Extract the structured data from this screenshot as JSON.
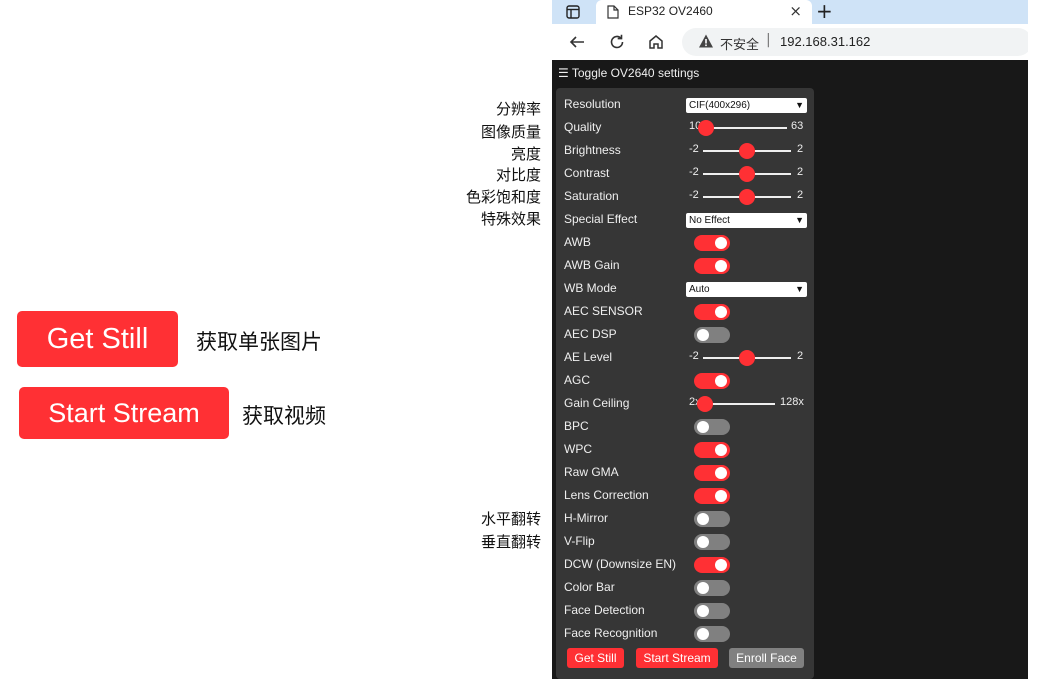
{
  "left": {
    "get_still_label": "Get Still",
    "get_still_note": "获取单张图片",
    "start_stream_label": "Start Stream",
    "start_stream_note": "获取视频"
  },
  "annotations": [
    "分辨率",
    "图像质量",
    "亮度",
    "对比度",
    "色彩饱和度",
    "特殊效果",
    "水平翻转",
    "垂直翻转"
  ],
  "browser": {
    "tab_title": "ESP32 OV2460",
    "tab_close": "×",
    "new_tab": "+",
    "insecure_label": "不安全",
    "separator": "|",
    "url": "192.168.31.162"
  },
  "panel": {
    "toggle_label": "☰ Toggle OV2640 settings",
    "resolution": {
      "label": "Resolution",
      "value": "CIF(400x296)"
    },
    "quality": {
      "label": "Quality",
      "min": "10",
      "max": "63",
      "value_fraction": 0.0
    },
    "brightness": {
      "label": "Brightness",
      "min": "-2",
      "max": "2",
      "value_fraction": 0.5
    },
    "contrast": {
      "label": "Contrast",
      "min": "-2",
      "max": "2",
      "value_fraction": 0.5
    },
    "saturation": {
      "label": "Saturation",
      "min": "-2",
      "max": "2",
      "value_fraction": 0.5
    },
    "special_effect": {
      "label": "Special Effect",
      "value": "No Effect"
    },
    "awb": {
      "label": "AWB",
      "on": true
    },
    "awb_gain": {
      "label": "AWB Gain",
      "on": true
    },
    "wb_mode": {
      "label": "WB Mode",
      "value": "Auto"
    },
    "aec_sensor": {
      "label": "AEC SENSOR",
      "on": true
    },
    "aec_dsp": {
      "label": "AEC DSP",
      "on": false
    },
    "ae_level": {
      "label": "AE Level",
      "min": "-2",
      "max": "2",
      "value_fraction": 0.5
    },
    "agc": {
      "label": "AGC",
      "on": true
    },
    "gain_ceiling": {
      "label": "Gain Ceiling",
      "min": "2x",
      "max": "128x",
      "value_fraction": 0.0
    },
    "bpc": {
      "label": "BPC",
      "on": false
    },
    "wpc": {
      "label": "WPC",
      "on": true
    },
    "raw_gma": {
      "label": "Raw GMA",
      "on": true
    },
    "lens_correction": {
      "label": "Lens Correction",
      "on": true
    },
    "h_mirror": {
      "label": "H-Mirror",
      "on": false
    },
    "v_flip": {
      "label": "V-Flip",
      "on": false
    },
    "dcw": {
      "label": "DCW (Downsize EN)",
      "on": true
    },
    "color_bar": {
      "label": "Color Bar",
      "on": false
    },
    "face_detection": {
      "label": "Face Detection",
      "on": false
    },
    "face_recognition": {
      "label": "Face Recognition",
      "on": false
    },
    "buttons": {
      "get_still": "Get Still",
      "start_stream": "Start Stream",
      "enroll_face": "Enroll Face"
    }
  },
  "colors": {
    "accent": "#ff3034",
    "panel_bg": "#363636",
    "switch_off": "#808080",
    "page_bg": "#181818"
  }
}
